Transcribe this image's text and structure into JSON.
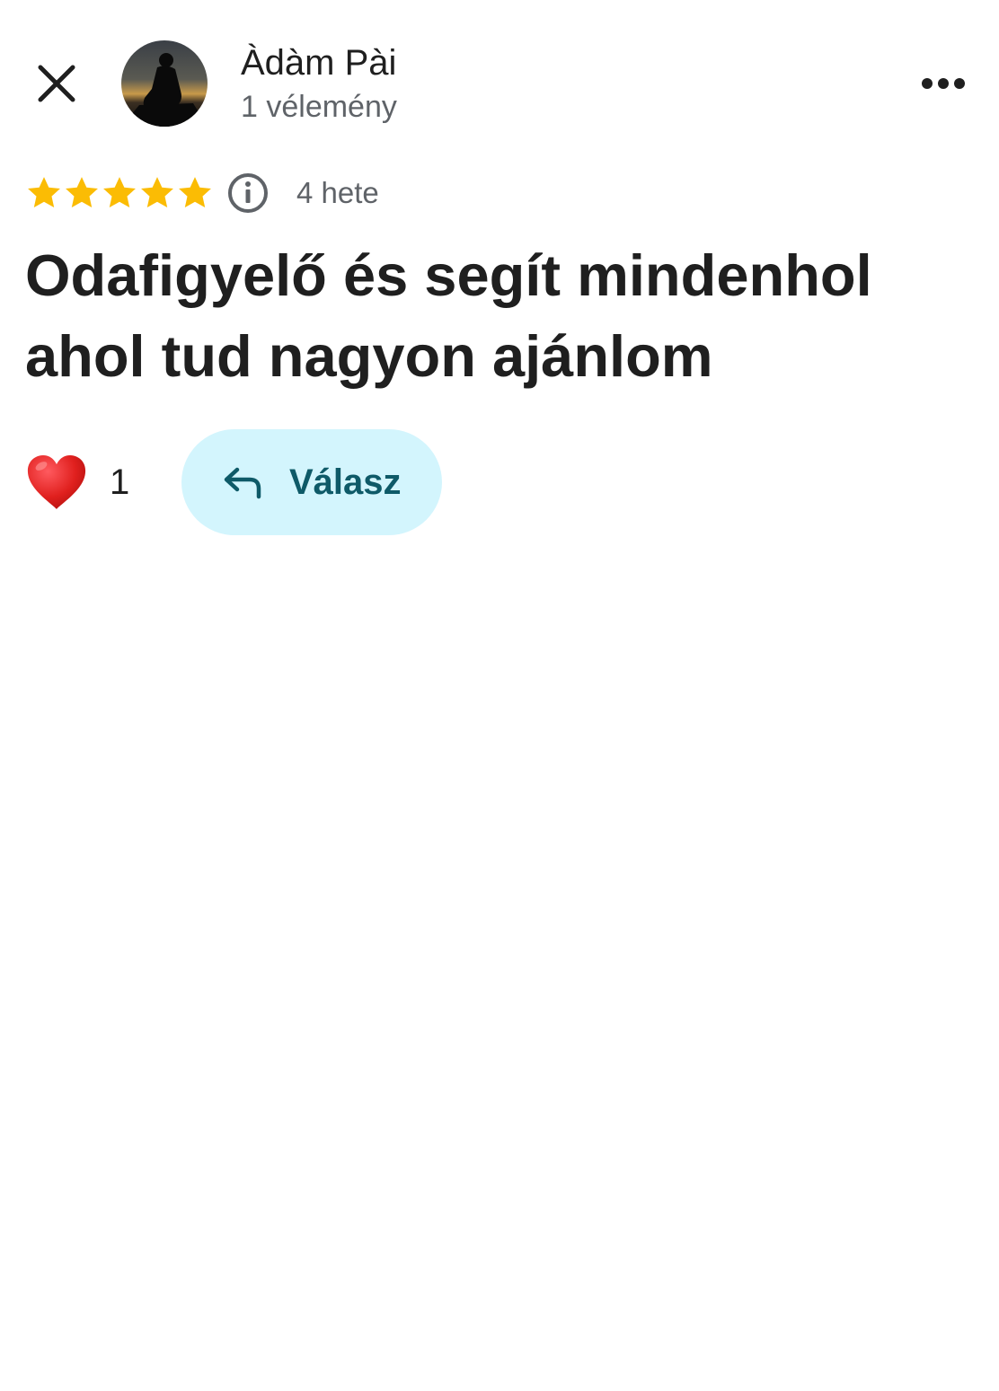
{
  "header": {
    "close_icon": "close-icon",
    "author_name": "Àdàm Pài",
    "review_count": "1 vélemény",
    "more_icon": "more-horizontal-icon"
  },
  "review": {
    "rating": 5,
    "rating_max": 5,
    "star_color": "#fbbc04",
    "info_icon": "info-icon",
    "age": "4 hete",
    "text": "Odafigyelő és segít mindenhol ahol tud nagyon ajánlom"
  },
  "actions": {
    "like_icon": "heart-icon",
    "like_count": "1",
    "reply_icon": "reply-arrow-icon",
    "reply_label": "Válasz",
    "reply_bg": "#d3f5fd",
    "reply_text_color": "#0e5a68"
  }
}
